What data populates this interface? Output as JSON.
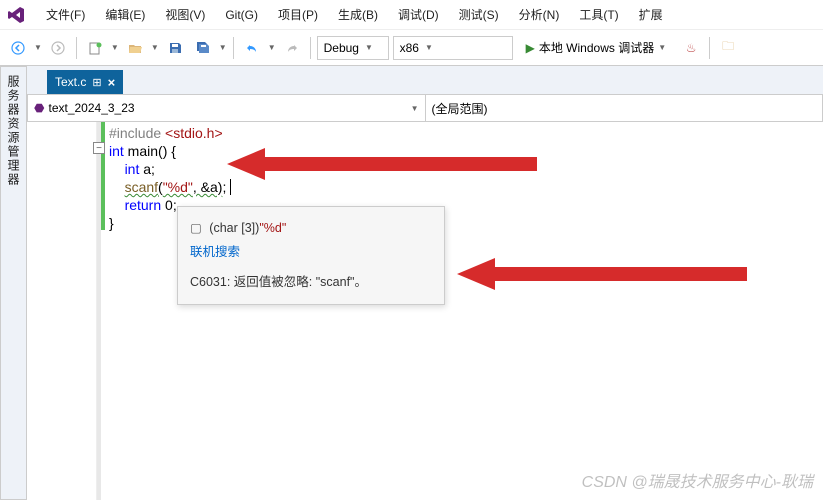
{
  "menu": {
    "items": [
      "文件(F)",
      "编辑(E)",
      "视图(V)",
      "Git(G)",
      "项目(P)",
      "生成(B)",
      "调试(D)",
      "测试(S)",
      "分析(N)",
      "工具(T)",
      "扩展"
    ]
  },
  "toolbar": {
    "configuration": "Debug",
    "platform": "x86",
    "debugger": "本地 Windows 调试器"
  },
  "side_panel": {
    "label": "服务器资源管理器"
  },
  "editor": {
    "tab_name": "Text.c",
    "project_selector": "text_2024_3_23",
    "scope_selector": "(全局范围)"
  },
  "code": {
    "line1_pre": "#include ",
    "line1_hdr": "<stdio.h>",
    "line2_kw1": "int",
    "line2_func": " main() {",
    "line3_kw": "int",
    "line3_rest": " a;",
    "line4_func": "scanf",
    "line4_open": "(",
    "line4_fmt": "\"%d\"",
    "line4_mid": ", &a)",
    "line4_end": ";",
    "line5_kw": "return",
    "line5_rest": " 0;",
    "line6": "}"
  },
  "tooltip": {
    "icon": "▢",
    "type_text": "(char [3])",
    "value": "\"%d\"",
    "link": "联机搜索",
    "warning": "C6031: 返回值被忽略: \"scanf\"。"
  },
  "watermark": "CSDN @瑞晟技术服务中心-耿瑞"
}
